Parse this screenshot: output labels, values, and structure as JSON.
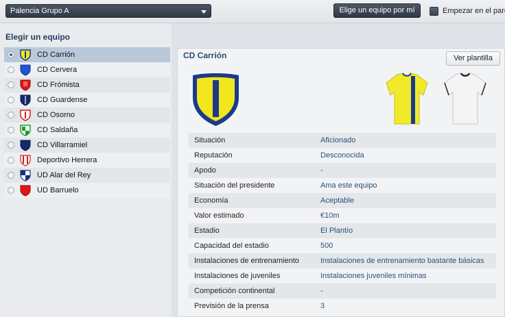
{
  "topbar": {
    "division": "Palencia Grupo A",
    "pick_button": "Elige un equipo por mí",
    "start_label": "Empezar en el paro"
  },
  "left": {
    "section_title": "Elegir un equipo",
    "teams": [
      {
        "name": "CD Carrión",
        "selected": true
      },
      {
        "name": "CD Cervera",
        "selected": false
      },
      {
        "name": "CD Frómista",
        "selected": false
      },
      {
        "name": "CD Guardense",
        "selected": false
      },
      {
        "name": "CD Osorno",
        "selected": false
      },
      {
        "name": "CD Saldaña",
        "selected": false
      },
      {
        "name": "CD Villarramiel",
        "selected": false
      },
      {
        "name": "Deportivo Herrera",
        "selected": false
      },
      {
        "name": "UD Alar del Rey",
        "selected": false
      },
      {
        "name": "UD Barruelo",
        "selected": false
      }
    ]
  },
  "detail": {
    "title": "CD Carrión",
    "squad_button": "Ver plantilla",
    "rows": [
      {
        "key": "Situación",
        "value": "Aficionado"
      },
      {
        "key": "Reputación",
        "value": "Desconocida"
      },
      {
        "key": "Apodo",
        "value": "-"
      },
      {
        "key": "Situación del presidente",
        "value": "Ama este equipo"
      },
      {
        "key": "Economía",
        "value": "Aceptable"
      },
      {
        "key": "Valor estimado",
        "value": "€10m"
      },
      {
        "key": "Estadio",
        "value": "El Plantío"
      },
      {
        "key": "Capacidad del estadio",
        "value": "500"
      },
      {
        "key": "Instalaciones de entrenamiento",
        "value": "Instalaciones de entrenamiento bastante básicas"
      },
      {
        "key": "Instalaciones de juveniles",
        "value": "Instalaciones juveniles mínimas"
      },
      {
        "key": "Competición continental",
        "value": "-"
      },
      {
        "key": "Previsión de la prensa",
        "value": "3"
      }
    ]
  },
  "colors": {
    "accent_text": "#2a4f7d",
    "home_kit_primary": "#f1ea2a",
    "home_kit_stripe": "#1b3a8a",
    "away_kit": "#f4f4f4"
  },
  "icons": [
    "chevron-down-icon",
    "team-crest-icon",
    "home-kit-icon",
    "away-kit-icon"
  ]
}
